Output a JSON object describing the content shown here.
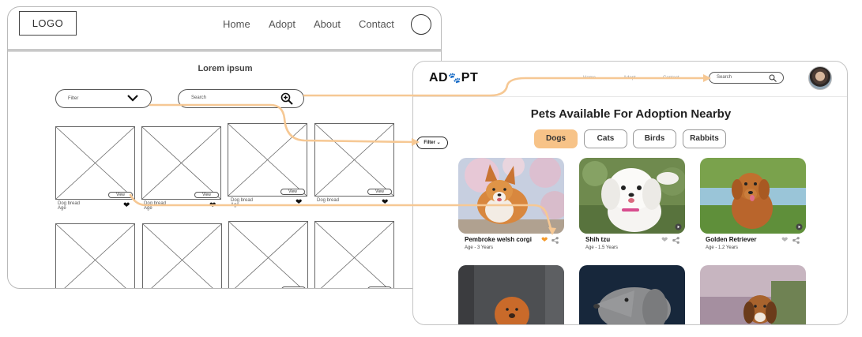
{
  "wireframe": {
    "logo": "LOGO",
    "nav": [
      "Home",
      "Adopt",
      "About",
      "Contact"
    ],
    "title": "Lorem ipsum",
    "filter_placeholder": "Filter",
    "search_placeholder": "Search",
    "view_label": "View",
    "card_name": "Dog bread",
    "card_age": "Age"
  },
  "hifi": {
    "logo_left": "AD",
    "logo_right": "PT",
    "nav": [
      "Home",
      "Adopt",
      "Contact"
    ],
    "search_placeholder": "Search",
    "title": "Pets Available For Adoption Nearby",
    "filter_label": "Filter",
    "tabs": [
      "Dogs",
      "Cats",
      "Birds",
      "Rabbits"
    ],
    "pets": [
      {
        "name": "Pembroke welsh corgi",
        "age": "Age - 3 Years",
        "favorited": true
      },
      {
        "name": "Shih tzu",
        "age": "Age - 1.5 Years",
        "favorited": false
      },
      {
        "name": "Golden Retriever",
        "age": "Age - 1.2 Years",
        "favorited": false
      }
    ]
  },
  "colors": {
    "accent": "#f7c388",
    "flow_line": "#f6c894",
    "heart_active": "#f59a2b",
    "heart_inactive": "#b5b5b5"
  },
  "icons": [
    "chevron-down-icon",
    "zoom-in-icon",
    "search-icon",
    "heart-icon",
    "share-icon",
    "paw-icon"
  ]
}
